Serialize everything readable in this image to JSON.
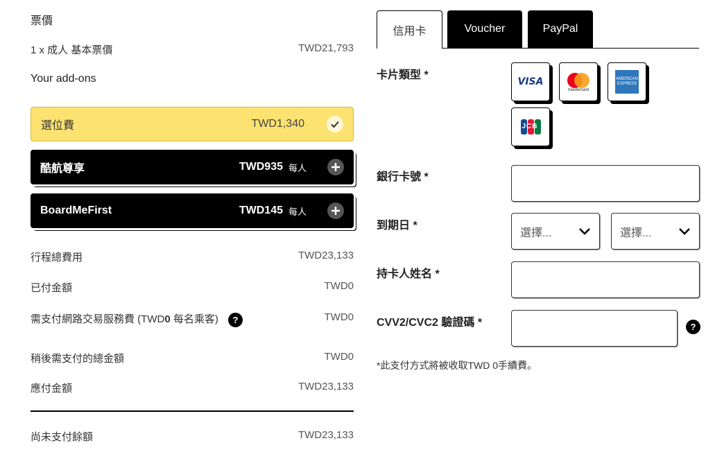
{
  "summary": {
    "fare_heading": "票價",
    "fare_line": {
      "label": "1 x 成人 基本票價",
      "value": "TWD21,793"
    },
    "addons_heading": "Your add-ons",
    "addons": [
      {
        "name": "選位費",
        "price": "TWD1,340",
        "per": "",
        "state": "selected"
      },
      {
        "name": "酷航尊享",
        "price": "TWD935",
        "per": "每人",
        "state": "add"
      },
      {
        "name": "BoardMeFirst",
        "price": "TWD145",
        "per": "每人",
        "state": "add"
      }
    ],
    "lines": [
      {
        "label": "行程總費用",
        "value": "TWD23,133"
      },
      {
        "label": "已付金額",
        "value": "TWD0"
      },
      {
        "label_prefix": "需支付網路交易服務費 (TWD",
        "label_bold": "0",
        "label_suffix": " 每名乘客)",
        "value": "TWD0"
      },
      {
        "label": "稍後需支付的總金額",
        "value": "TWD0"
      },
      {
        "label": "應付金額",
        "value": "TWD23,133"
      }
    ],
    "balance": {
      "label": "尚未支付餘額",
      "value": "TWD23,133"
    }
  },
  "payment": {
    "tabs": [
      "信用卡",
      "Voucher",
      "PayPal"
    ],
    "card_type_label": "卡片類型 *",
    "cards": [
      {
        "name": "visa",
        "text": "VISA"
      },
      {
        "name": "mastercard",
        "text": "mastercard"
      },
      {
        "name": "amex",
        "text": "AMERICAN EXPRESS"
      },
      {
        "name": "jcb",
        "text": "JCB"
      }
    ],
    "card_number_label": "銀行卡號 *",
    "expiry_label": "到期日 *",
    "month_select": "選擇...",
    "year_select": "選擇...",
    "name_label": "持卡人姓名 *",
    "cvv_label": "CVV2/CVC2 驗證碼 *",
    "help_icon_text": "?",
    "note": "*此支付方式將被收取TWD 0手續費。"
  }
}
